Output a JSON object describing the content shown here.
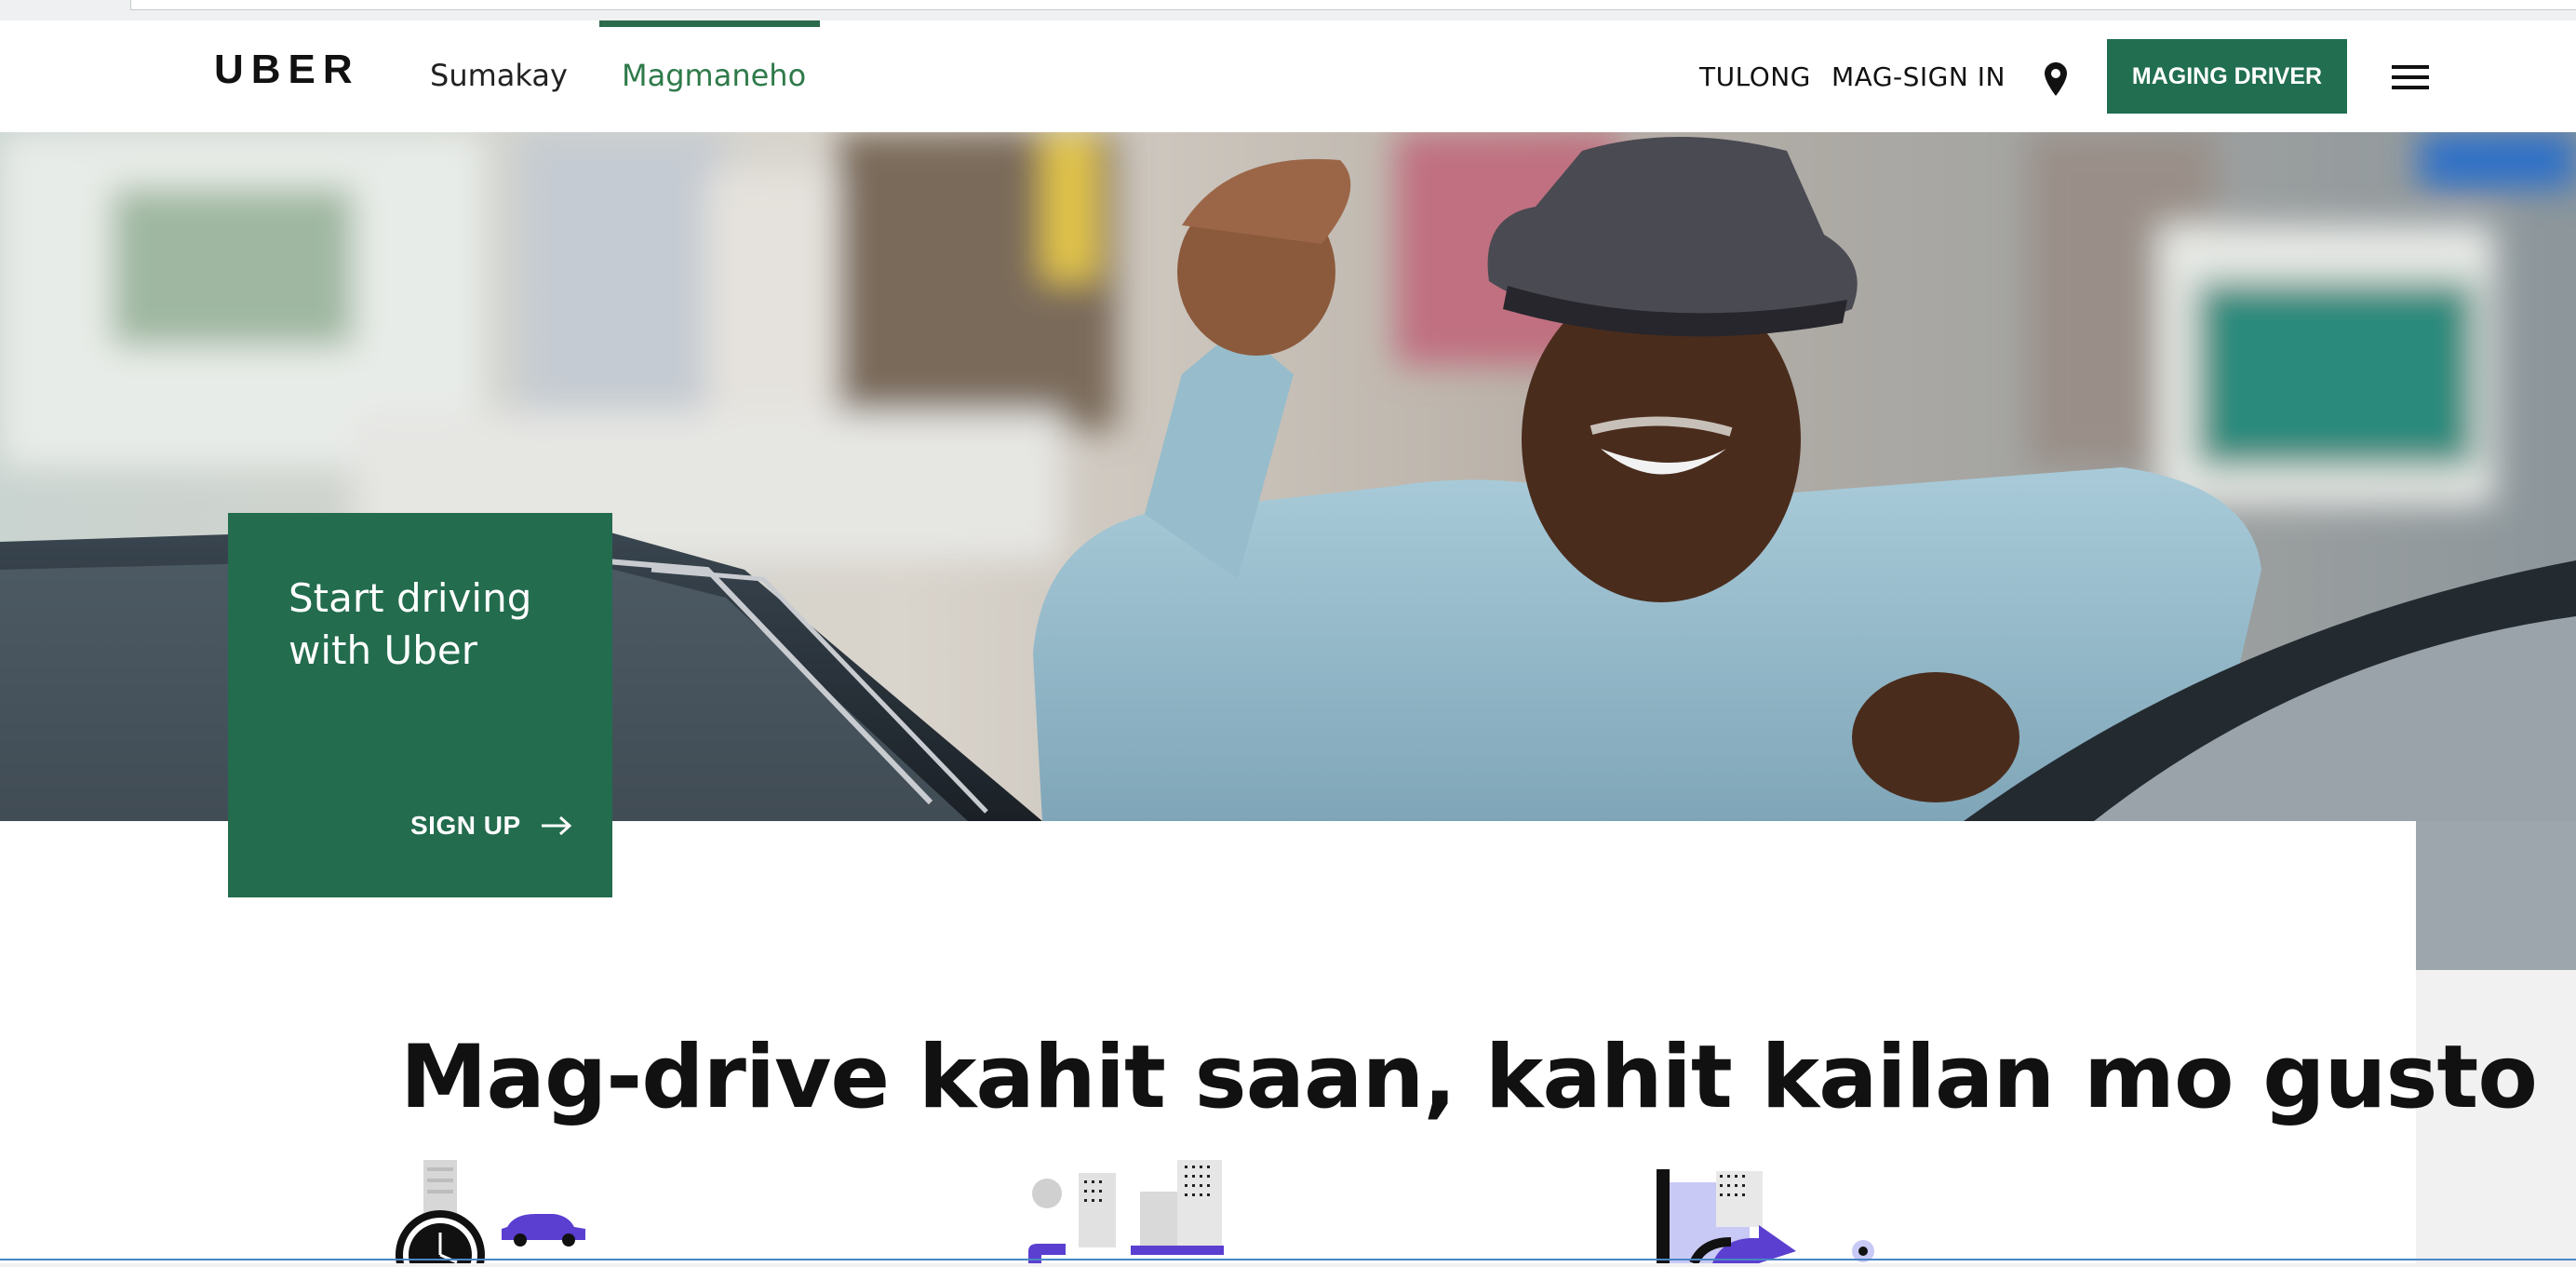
{
  "nav": {
    "logo": "UBER",
    "links": [
      {
        "label": "Sumakay",
        "active": false
      },
      {
        "label": "Magmaneho",
        "active": true
      }
    ],
    "help": "TULONG",
    "signin": "MAG-SIGN IN",
    "cta": "MAGING DRIVER",
    "icons": {
      "location": "location-pin-icon",
      "menu": "hamburger-menu-icon"
    }
  },
  "hero": {
    "promo_title": "Start driving with Uber",
    "promo_link": "SIGN UP",
    "promo_icon": "arrow-right-icon"
  },
  "main": {
    "headline": "Mag-drive kahit saan, kahit kailan mo gusto"
  },
  "colors": {
    "brand_green": "#236c4e",
    "active_link": "#2f7a4a",
    "illustration_purple": "#5b3fd0"
  }
}
